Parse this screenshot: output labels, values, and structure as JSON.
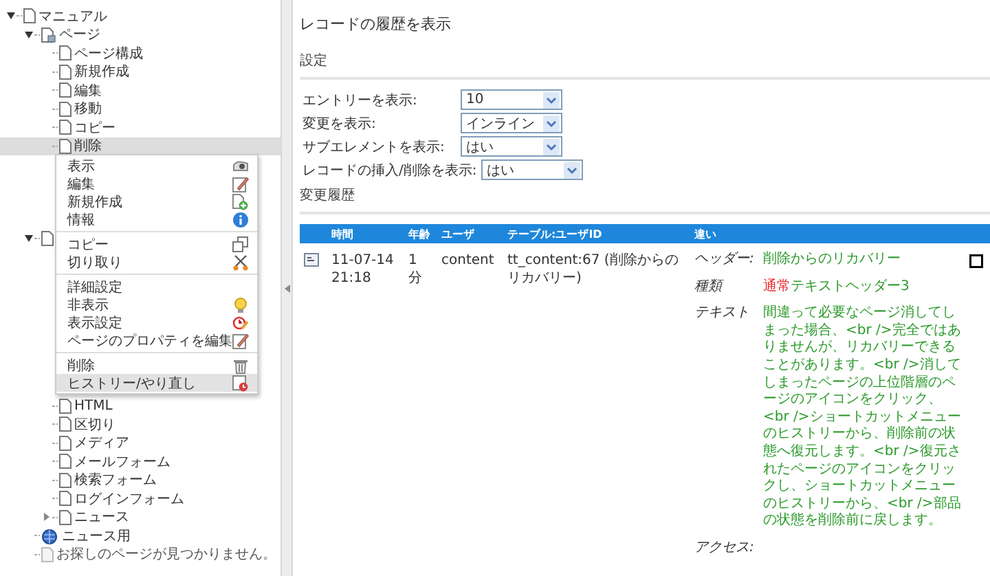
{
  "tree": [
    {
      "label": "マニュアル",
      "kind": "page",
      "expanded": true,
      "children": [
        {
          "label": "ページ",
          "kind": "special",
          "expanded": true,
          "children": [
            {
              "label": "ページ構成",
              "kind": "page",
              "selected": false
            },
            {
              "label": "新規作成",
              "kind": "page",
              "selected": false
            },
            {
              "label": "編集",
              "kind": "page",
              "selected": false
            },
            {
              "label": "移動",
              "kind": "page",
              "selected": false
            },
            {
              "label": "コピー",
              "kind": "page",
              "selected": false
            },
            {
              "label": "削除",
              "kind": "page",
              "selected": true
            }
          ]
        },
        {
          "kind": "page",
          "expanded": true,
          "children": [
            {
              "label": "HTML",
              "kind": "page",
              "selected": false
            },
            {
              "label": "区切り",
              "kind": "page",
              "selected": false
            },
            {
              "label": "メディア",
              "kind": "page",
              "selected": false
            },
            {
              "label": "メールフォーム",
              "kind": "page",
              "selected": false
            },
            {
              "label": "検索フォーム",
              "kind": "page",
              "selected": false
            },
            {
              "label": "ログインフォーム",
              "kind": "page",
              "selected": false
            },
            {
              "label": "ニュース",
              "kind": "page",
              "expanded": false,
              "selected": false
            }
          ]
        },
        {
          "label": "ニュース用",
          "kind": "folder",
          "selected": false
        },
        {
          "label": "お探しのページが見つかりません。",
          "kind": "muted",
          "selected": false
        }
      ]
    }
  ],
  "context_menu": [
    {
      "label": "表示",
      "kind": "view",
      "separator_before": false,
      "selected": false
    },
    {
      "label": "編集",
      "kind": "edit",
      "separator_before": false,
      "selected": false
    },
    {
      "label": "新規作成",
      "kind": "new",
      "separator_before": false,
      "selected": false
    },
    {
      "label": "情報",
      "kind": "info",
      "separator_before": false,
      "selected": false
    },
    {
      "label": "コピー",
      "kind": "copy",
      "separator_before": true,
      "selected": false
    },
    {
      "label": "切り取り",
      "kind": "cut",
      "separator_before": false,
      "selected": false
    },
    {
      "label": "詳細設定",
      "kind": "plain",
      "separator_before": true,
      "selected": false
    },
    {
      "label": "非表示",
      "kind": "hide",
      "separator_before": false,
      "selected": false
    },
    {
      "label": "表示設定",
      "kind": "display",
      "separator_before": false,
      "selected": false
    },
    {
      "label": "ページのプロパティを編集",
      "kind": "edit",
      "separator_before": false,
      "selected": false
    },
    {
      "label": "削除",
      "kind": "delete",
      "separator_before": true,
      "selected": false
    },
    {
      "label": "ヒストリー/やり直し",
      "kind": "history",
      "separator_before": false,
      "selected": true
    }
  ],
  "title": "レコードの履歴を表示",
  "settings": {
    "heading": "設定",
    "fields": [
      {
        "label": "エントリーを表示:",
        "value": "10"
      },
      {
        "label": "変更を表示:",
        "value": "インライン"
      },
      {
        "label": "サブエレメントを表示:",
        "value": "はい"
      },
      {
        "label": "レコードの挿入/削除を表示:",
        "value": "はい"
      }
    ]
  },
  "history": {
    "heading": "変更履歴",
    "columns": [
      "時間",
      "年齢",
      "ユーザ",
      "テーブル:ユーザID",
      "違い"
    ],
    "rows": [
      {
        "time": [
          "11-07-14",
          "21:18"
        ],
        "age": [
          "1",
          "分"
        ],
        "user": "content",
        "record": "tt_content:67 (削除からのリカバリー)",
        "diff": [
          {
            "label": "ヘッダー:",
            "segments": [
              {
                "kind": "added",
                "text": "削除からのリカバリー"
              }
            ]
          },
          {
            "label": "種類",
            "segments": [
              {
                "kind": "removed",
                "text": "通常"
              },
              {
                "kind": "added",
                "text": "テキストヘッダー3"
              }
            ]
          },
          {
            "label": "テキスト",
            "segments": [
              {
                "kind": "added",
                "text": "間違って必要なページ消してしまった場合、<br />完全ではありませんが、リカバリーできることがあります。<br />消してしまったページの上位階層のページのアイコンをクリック、<br />ショートカットメニューのヒストリーから、削除前の状態へ復元します。<br />復元されたページのアイコンをクリックし、ショートカットメニューのヒストリーから、<br />部品の状態を削除前に戻します。"
              }
            ]
          },
          {
            "label": "アクセス:"
          }
        ]
      }
    ]
  }
}
